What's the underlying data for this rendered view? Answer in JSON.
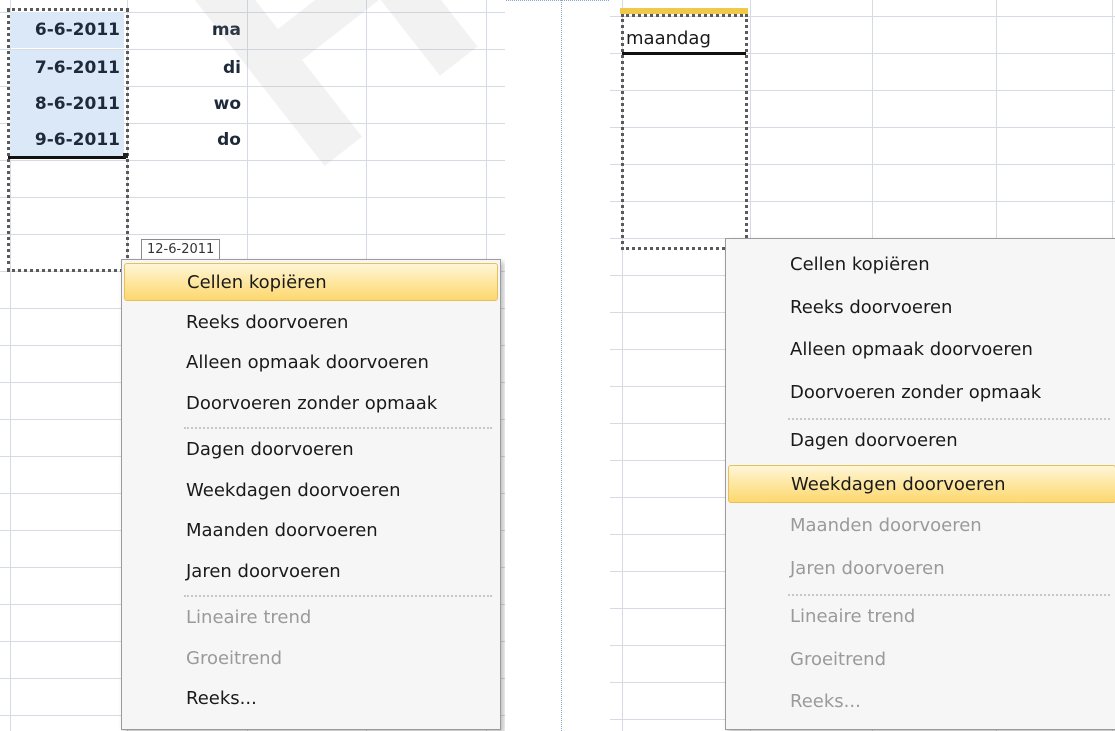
{
  "left": {
    "dates": [
      "6-6-2011",
      "7-6-2011",
      "8-6-2011",
      "9-6-2011"
    ],
    "days": [
      "ma",
      "di",
      "wo",
      "do"
    ],
    "tooltip": "12-6-2011",
    "menu": [
      {
        "label": "Cellen kopiëren",
        "disabled": false,
        "highlighted": true
      },
      {
        "label": "Reeks doorvoeren",
        "disabled": false,
        "highlighted": false
      },
      {
        "label": "Alleen opmaak doorvoeren",
        "disabled": false,
        "highlighted": false
      },
      {
        "label": "Doorvoeren zonder opmaak",
        "disabled": false,
        "highlighted": false
      },
      {
        "label": "Dagen doorvoeren",
        "disabled": false,
        "highlighted": false
      },
      {
        "label": "Weekdagen doorvoeren",
        "disabled": false,
        "highlighted": false
      },
      {
        "label": "Maanden doorvoeren",
        "disabled": false,
        "highlighted": false
      },
      {
        "label": "Jaren doorvoeren",
        "disabled": false,
        "highlighted": false
      },
      {
        "label": "Lineaire trend",
        "disabled": true,
        "highlighted": false
      },
      {
        "label": "Groeitrend",
        "disabled": true,
        "highlighted": false
      },
      {
        "label": "Reeks...",
        "disabled": false,
        "highlighted": false
      }
    ]
  },
  "right": {
    "cell": "maandag",
    "menu": [
      {
        "label": "Cellen kopiëren",
        "disabled": false,
        "highlighted": false
      },
      {
        "label": "Reeks doorvoeren",
        "disabled": false,
        "highlighted": false
      },
      {
        "label": "Alleen opmaak doorvoeren",
        "disabled": false,
        "highlighted": false
      },
      {
        "label": "Doorvoeren zonder opmaak",
        "disabled": false,
        "highlighted": false
      },
      {
        "label": "Dagen doorvoeren",
        "disabled": false,
        "highlighted": false
      },
      {
        "label": "Weekdagen doorvoeren",
        "disabled": false,
        "highlighted": true
      },
      {
        "label": "Maanden doorvoeren",
        "disabled": true,
        "highlighted": false
      },
      {
        "label": "Jaren doorvoeren",
        "disabled": true,
        "highlighted": false
      },
      {
        "label": "Lineaire trend",
        "disabled": true,
        "highlighted": false
      },
      {
        "label": "Groeitrend",
        "disabled": true,
        "highlighted": false
      },
      {
        "label": "Reeks...",
        "disabled": true,
        "highlighted": false
      }
    ]
  },
  "watermark": "Help",
  "colors": {
    "selection": "#dbe8f8",
    "highlight": "#fde59b",
    "disabled_text": "#9a9a9a"
  }
}
